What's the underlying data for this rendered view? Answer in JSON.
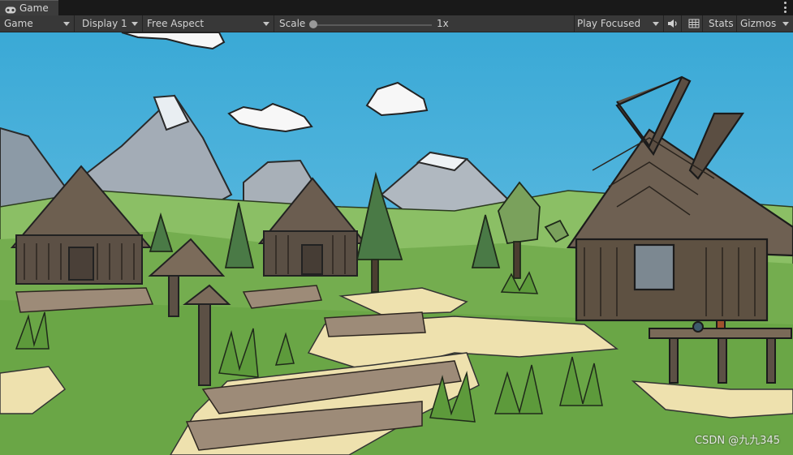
{
  "window": {
    "tab_label": "Game",
    "tab_icon": "gamepad-icon"
  },
  "toolbar": {
    "view_mode": "Game",
    "display": "Display 1",
    "aspect": "Free Aspect",
    "scale_label": "Scale",
    "scale_value": "1x",
    "scale_level": 0,
    "play_mode": "Play Focused",
    "audio_icon": "speaker-icon",
    "stats_icon": "grid-icon",
    "stats_label": "Stats",
    "gizmos_label": "Gizmos"
  },
  "scene": {
    "sky_color": "#4fb3dc",
    "grass_color": "#74ad4f",
    "path_color": "#efe3b0",
    "wood_color": "#5e5142",
    "mountain_color": "#9aa3ad"
  },
  "watermark": "CSDN @九九345"
}
